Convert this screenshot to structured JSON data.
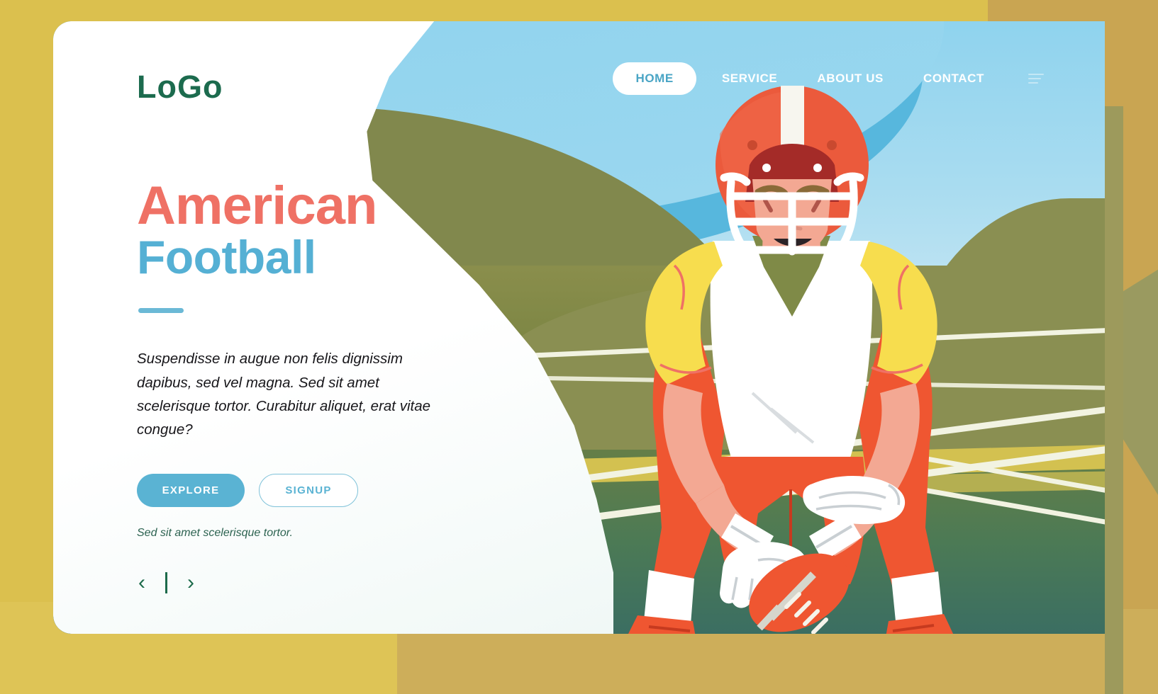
{
  "brand": {
    "logo_text": "LoGo",
    "logo_color": "#1c6b4e"
  },
  "nav": {
    "items": [
      {
        "label": "HOME",
        "active": true
      },
      {
        "label": "SERVICE",
        "active": false
      },
      {
        "label": "ABOUT US",
        "active": false
      },
      {
        "label": "CONTACT",
        "active": false
      }
    ],
    "menu_icon": "hamburger-icon"
  },
  "hero": {
    "title_line1": "American",
    "title_line2": "Football",
    "title_line1_color": "#ef7165",
    "title_line2_color": "#55b0d4",
    "body": "Suspendisse in augue non felis dignissim dapibus, sed vel magna. Sed sit amet scelerisque tortor. Curabitur aliquet, erat vitae congue?",
    "tagline": "Sed sit amet scelerisque tortor.",
    "primary_button": "EXPLORE",
    "secondary_button": "SIGNUP"
  },
  "carousel": {
    "prev": "‹",
    "divider": "",
    "next": "›"
  },
  "theme": {
    "frame": "#dbc04e",
    "accent_blue": "#5ab3d3",
    "accent_red": "#ef7165",
    "accent_green": "#1c6b4e",
    "card_bg": "#ffffff",
    "sky": "#8fd3ee",
    "turf": "#74813f"
  },
  "illustration": {
    "subject": "american-football-player",
    "helmet_color": "#eb5a3c",
    "jersey_color": "#f7dd4e",
    "pants_color": "#ef5631",
    "ball_color": "#ef5631"
  }
}
